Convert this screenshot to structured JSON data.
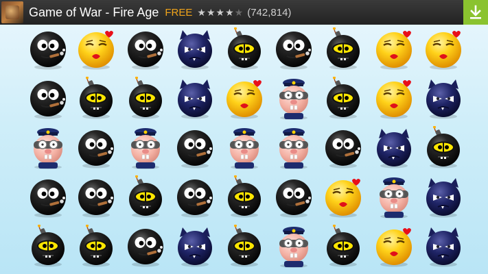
{
  "ad": {
    "title": "Game of War - Fire Age",
    "price": "FREE",
    "rating_stars": 4,
    "rating_max": 5,
    "review_count": "(742,814)",
    "install_icon": "download-icon"
  },
  "board": {
    "columns": 9,
    "rows": 5,
    "tiles": [
      [
        "blackface",
        "yellowkiss",
        "blackface",
        "devil",
        "bomb",
        "blackface",
        "bomb",
        "yellowkiss",
        "yellowkiss"
      ],
      [
        "blackface",
        "bomb",
        "bomb",
        "devil",
        "yellowkiss",
        "police",
        "bomb",
        "yellowkiss",
        "devil"
      ],
      [
        "police",
        "blackface",
        "police",
        "blackface",
        "police",
        "police",
        "blackface",
        "devil",
        "bomb"
      ],
      [
        "blackface",
        "blackface",
        "bomb",
        "blackface",
        "bomb",
        "blackface",
        "yellowkiss",
        "police",
        "devil"
      ],
      [
        "bomb",
        "bomb",
        "blackface",
        "devil",
        "bomb",
        "police",
        "bomb",
        "yellowkiss",
        "devil"
      ]
    ]
  },
  "colors": {
    "background_top": "#eaf7fd",
    "background_bottom": "#b9e5f6",
    "ad_bar": "#2b2b2b",
    "ad_free": "#f2a51a",
    "install_button": "#8ac32f"
  }
}
